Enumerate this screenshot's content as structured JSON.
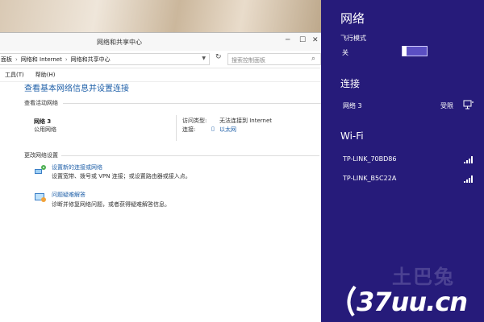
{
  "window": {
    "title": "网络和共享中心",
    "breadcrumb": [
      "面板",
      "网络和 Internet",
      "网络和共享中心"
    ],
    "search_placeholder": "搜索控制面板",
    "menu": [
      "工具(T)",
      "帮助(H)"
    ]
  },
  "main": {
    "heading": "查看基本网络信息并设置连接",
    "active_label": "查看活动网络",
    "network_name": "网络 3",
    "network_type": "公用网络",
    "access_type_label": "访问类型:",
    "access_type_value": "无法连接到 Internet",
    "connection_label": "连接:",
    "connection_value": "以太网",
    "change_label": "更改网络设置",
    "tasks": [
      {
        "title": "设置新的连接或网络",
        "desc": "设置宽带、拨号或 VPN 连接；或设置路由器或接入点。"
      },
      {
        "title": "问题疑难解答",
        "desc": "诊断并修复网络问题，或者获得疑难解答信息。"
      }
    ]
  },
  "panel": {
    "title": "网络",
    "airplane_label": "飞行模式",
    "airplane_value": "关",
    "airplane_on": false,
    "connections_label": "连接",
    "connection_name": "网络 3",
    "connection_status": "受限",
    "wifi_label": "Wi-Fi",
    "wifi_networks": [
      "TP-LINK_70BD86",
      "TP-LINK_B5C22A"
    ]
  },
  "watermark": {
    "brand_cn": "土巴兔",
    "domain": "37uu.cn"
  },
  "colors": {
    "panel_bg": "#261b7a",
    "link": "#1e5fa8"
  }
}
